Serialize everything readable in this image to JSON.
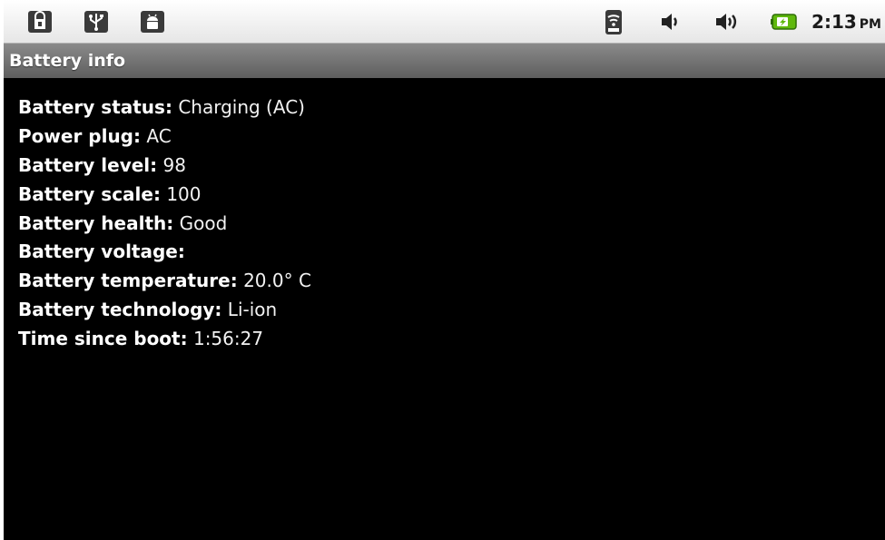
{
  "status_bar": {
    "left_icons": [
      "lock-bag-icon",
      "usb-icon",
      "android-debug-icon"
    ],
    "right_icons": [
      "signal-icon",
      "volume-icon",
      "volume-loud-icon",
      "battery-charging-icon"
    ],
    "time": "2:13",
    "ampm": "PM",
    "accent_color": "#5fb80d"
  },
  "title_bar": {
    "title": "Battery info"
  },
  "info": [
    {
      "label": "Battery status:",
      "value": "Charging (AC)"
    },
    {
      "label": "Power plug:",
      "value": "AC"
    },
    {
      "label": "Battery level:",
      "value": "98"
    },
    {
      "label": "Battery scale:",
      "value": "100"
    },
    {
      "label": "Battery health:",
      "value": "Good"
    },
    {
      "label": "Battery voltage:",
      "value": ""
    },
    {
      "label": "Battery temperature:",
      "value": "20.0° C"
    },
    {
      "label": "Battery technology:",
      "value": "Li-ion"
    },
    {
      "label": "Time since boot:",
      "value": "1:56:27"
    }
  ]
}
